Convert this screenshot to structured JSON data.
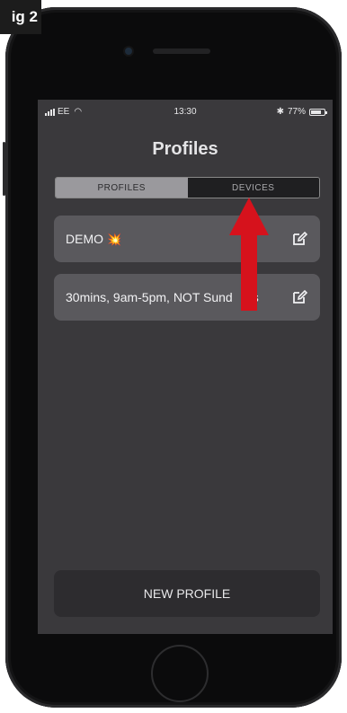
{
  "figure_label": "ig 2",
  "status_bar": {
    "carrier": "EE",
    "time": "13:30",
    "battery": "77%",
    "battery_level": 0.77
  },
  "page_title": "Profiles",
  "tabs": [
    {
      "label": "PROFILES",
      "active": true
    },
    {
      "label": "DEVICES",
      "active": false
    }
  ],
  "profiles": [
    {
      "label": "DEMO",
      "icon": "spark-emoji-icon"
    },
    {
      "label": "30mins, 9am-5pm, NOT Sund",
      "label_after": "s"
    }
  ],
  "new_profile_button": "NEW PROFILE",
  "colors": {
    "screen_bg": "#3a393c",
    "card_bg": "#5a595d",
    "arrow": "#d6121c"
  }
}
